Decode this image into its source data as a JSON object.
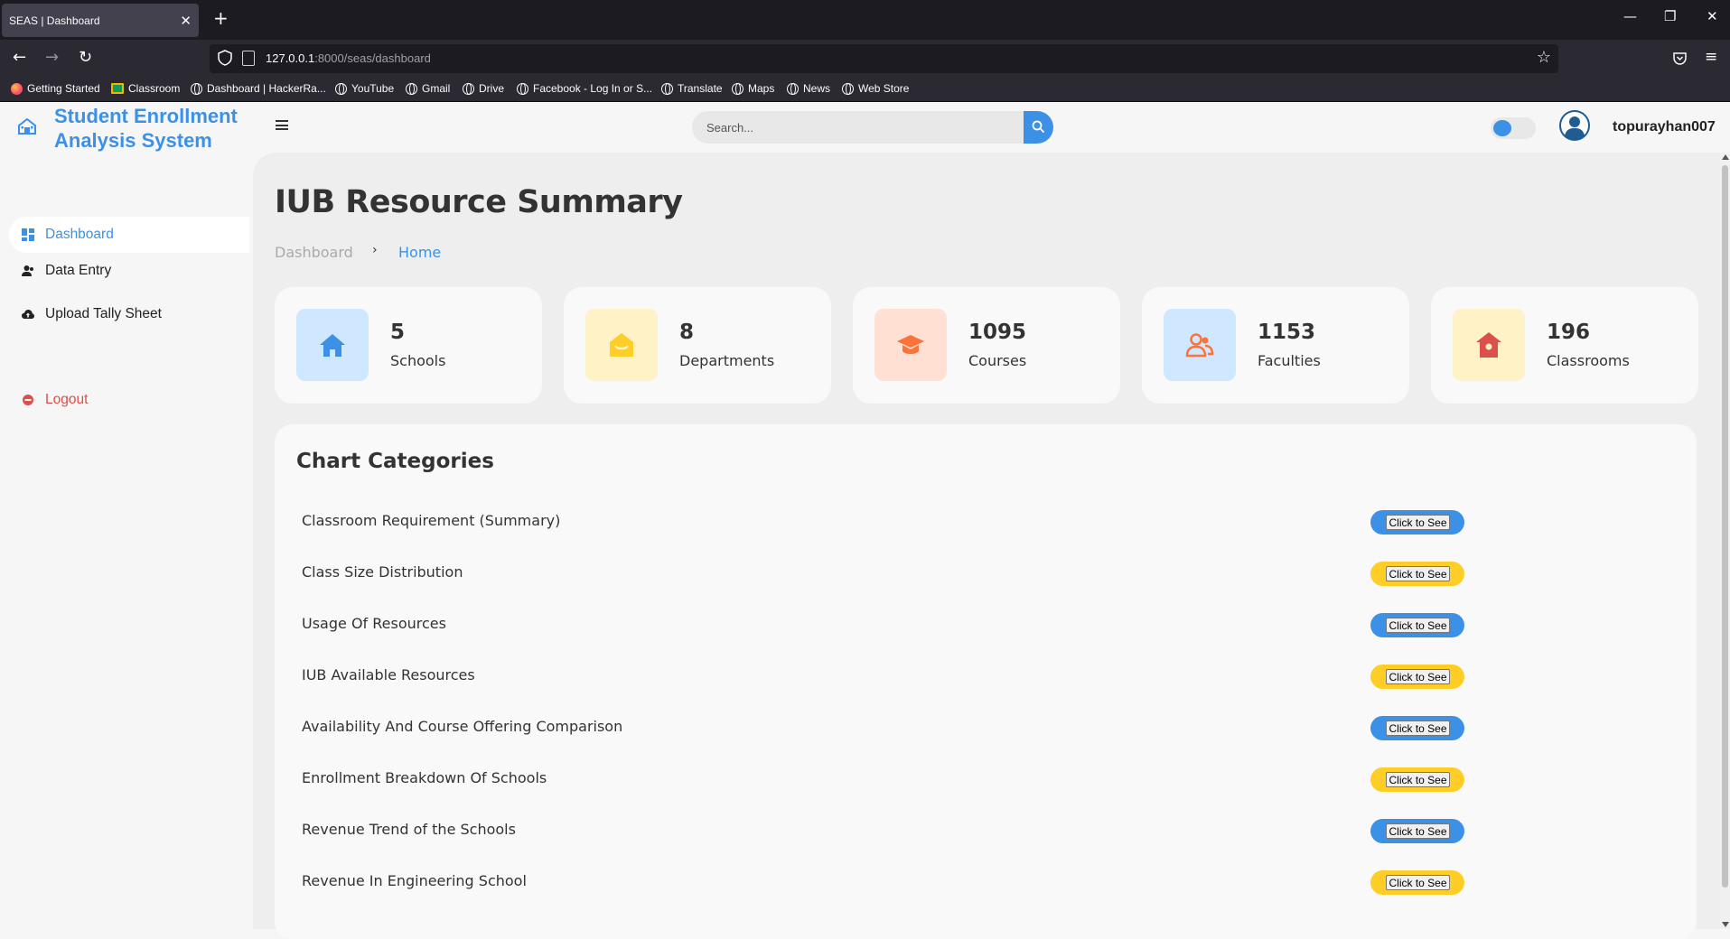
{
  "browser": {
    "tab_title": "SEAS | Dashboard",
    "url_host": "127.0.0.1",
    "url_path": ":8000/seas/dashboard",
    "bookmarks": [
      "Getting Started",
      "Classroom",
      "Dashboard | HackerRa...",
      "YouTube",
      "Gmail",
      "Drive",
      "Facebook - Log In or S...",
      "Translate",
      "Maps",
      "News",
      "Web Store"
    ]
  },
  "brand": {
    "line1": "Student Enrollment",
    "line2": "Analysis System"
  },
  "search": {
    "placeholder": "Search..."
  },
  "user": {
    "name": "topurayhan007"
  },
  "sidebar": {
    "items": [
      {
        "label": "Dashboard",
        "icon": "dashboard-grid-icon",
        "active": true
      },
      {
        "label": "Data Entry",
        "icon": "user-icon"
      },
      {
        "label": "Upload Tally Sheet",
        "icon": "cloud-upload-icon"
      }
    ],
    "logout": "Logout"
  },
  "page": {
    "title": "IUB Resource Summary",
    "breadcrumb": [
      "Dashboard",
      "Home"
    ]
  },
  "stats": [
    {
      "value": "5",
      "label": "Schools",
      "icon": "home-icon",
      "bg": "#cfe8ff",
      "fg": "#3c91e6"
    },
    {
      "value": "8",
      "label": "Departments",
      "icon": "building-icon",
      "bg": "#fff2c6",
      "fg": "#ffce26"
    },
    {
      "value": "1095",
      "label": "Courses",
      "icon": "graduation-cap-icon",
      "bg": "#ffe0d3",
      "fg": "#fd7238"
    },
    {
      "value": "1153",
      "label": "Faculties",
      "icon": "people-icon",
      "bg": "#cfe8ff",
      "fg": "#fd7238"
    },
    {
      "value": "196",
      "label": "Classrooms",
      "icon": "classroom-icon",
      "bg": "#fff2c6",
      "fg": "#db504a"
    }
  ],
  "charts": {
    "title": "Chart Categories",
    "button_label": "Click to See",
    "items": [
      {
        "label": "Classroom Requirement (Summary)",
        "color": "blue"
      },
      {
        "label": "Class Size Distribution",
        "color": "yellow"
      },
      {
        "label": "Usage Of Resources",
        "color": "blue"
      },
      {
        "label": "IUB Available Resources",
        "color": "yellow"
      },
      {
        "label": "Availability And Course Offering Comparison",
        "color": "blue"
      },
      {
        "label": "Enrollment Breakdown Of Schools",
        "color": "yellow"
      },
      {
        "label": "Revenue Trend of the Schools",
        "color": "blue"
      },
      {
        "label": "Revenue In Engineering School",
        "color": "yellow"
      }
    ]
  },
  "colors": {
    "accent": "#3c91e6",
    "yellow": "#ffce26",
    "danger": "#db504a"
  }
}
